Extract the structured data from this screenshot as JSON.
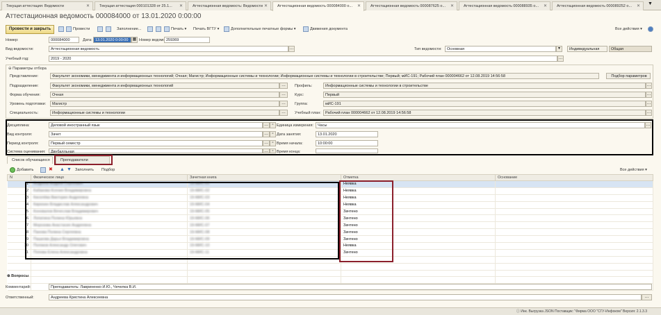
{
  "tabs": [
    {
      "label": "Текущая аттестация: Ведомости"
    },
    {
      "label": "Текущая аттестация 000101328 от 25.1..."
    },
    {
      "label": "Аттестационная ведомость: Ведомости"
    },
    {
      "label": "Аттестационная ведомость 000084000 о..."
    },
    {
      "label": "Аттестационная ведомость 000087625 о..."
    },
    {
      "label": "Аттестационная ведомость 000088935 о..."
    },
    {
      "label": "Аттестационная ведомость 000089252 о..."
    }
  ],
  "title": "Аттестационная ведомость 000084000 от 13.01.2020 0:00:00",
  "toolbar": {
    "post_close": "Провести и закрыть",
    "post": "Провести",
    "fill": "Заполнение...",
    "print": "Печать",
    "print_vgtu": "Печать ВГТУ",
    "extra_print": "Дополнительные печатные формы",
    "movements": "Движения документа",
    "all_actions": "Все действия"
  },
  "header": {
    "number_label": "Номер:",
    "number": "000084000",
    "date_label": "Дата:",
    "date": "13.01.2020 0:00:00",
    "num_ved_label": "Номер ведомости:",
    "num_ved": "259369",
    "kind_label": "Вид ведомости:",
    "kind": "Аттестационная ведомость",
    "type_label": "Тип ведомости:",
    "type": "Основная",
    "opt1": "Индивидуальная",
    "opt2": "Общая",
    "year_label": "Учебный год:",
    "year": "2019 - 2020"
  },
  "params": {
    "title": "Параметры отбора",
    "view_label": "Представление:",
    "view": "Факультет экономики, менеджмента и информационных технологий; Очная; Магистр; Информационные системы и технологии; Информационные системы и технологии в строительстве; Первый; мИС-191; Рабочий план 000004662 от 12.08.2019 14:56:58",
    "pick_btn": "Подбор параметров",
    "dept_label": "Подразделение:",
    "dept": "Факультет экономики, менеджмента и информационных технологий",
    "profile_label": "Профиль:",
    "profile": "Информационные системы и технологии в строительстве",
    "form_label": "Форма обучения:",
    "form": "Очная",
    "course_label": "Курс:",
    "course": "Первый",
    "level_label": "Уровень подготовки:",
    "level": "Магистр",
    "group_label": "Группа:",
    "group": "мИС-191",
    "spec_label": "Специальность:",
    "spec": "Информационные системы и технологии",
    "plan_label": "Учебный план:",
    "plan": "Рабочий план 000004662 от 12.08.2019 14:56:58"
  },
  "disc": {
    "disc_label": "Дисциплина:",
    "disc": "Деловой иностранный язык",
    "unit_label": "Единица измерения:",
    "unit": "Часы",
    "control_label": "Вид контроля:",
    "control": "Зачет",
    "date_label": "Дата занятия:",
    "date": "13.01.2020",
    "period_label": "Период контроля:",
    "period": "Первый семестр",
    "start_label": "Время начала:",
    "start": "10:00:00",
    "system_label": "Система оценивания:",
    "system": "Двубалльная",
    "end_label": "Время конца:"
  },
  "subtabs": {
    "students": "Список обучающихся",
    "teachers": "Преподаватели"
  },
  "gridbar": {
    "add": "Добавить",
    "fill": "Заполнить",
    "pick": "Подбор",
    "all_actions": "Все действия"
  },
  "grid": {
    "columns": [
      "N",
      "Физическое лицо",
      "Зачетная книга",
      "Отметка",
      "Основание"
    ],
    "rows": [
      {
        "n": "1",
        "person": "Андреев Андрей Сергеевич",
        "book": "19-МИС-01",
        "mark": "Неявка"
      },
      {
        "n": "2",
        "person": "Кабакова Ксения Владимировна",
        "book": "19-МИС-02",
        "mark": "Неявка"
      },
      {
        "n": "3",
        "person": "Киселёва Виктория Андреевна",
        "book": "19-МИС-03",
        "mark": "Неявка"
      },
      {
        "n": "4",
        "person": "Кирюхин Владислав Александрович",
        "book": "19-МИС-04",
        "mark": "Неявка"
      },
      {
        "n": "5",
        "person": "Коновалов Вячеслав Владимирович",
        "book": "19-МИС-05",
        "mark": "Зачтено"
      },
      {
        "n": "6",
        "person": "Лопатина Полина Юрьевна",
        "book": "19-МИС-06",
        "mark": "Зачтено"
      },
      {
        "n": "7",
        "person": "Морозова Анастасия Андреевна",
        "book": "19-МИС-07",
        "mark": "Зачтено"
      },
      {
        "n": "8",
        "person": "Панова Полина Сергеевна",
        "book": "19-МИС-08",
        "mark": "Зачтено"
      },
      {
        "n": "9",
        "person": "Пашкова Дарья Владимировна",
        "book": "19-МИС-09",
        "mark": "Зачтено"
      },
      {
        "n": "10",
        "person": "Поляков Александр Олегович",
        "book": "19-МИС-10",
        "mark": "Неявка"
      },
      {
        "n": "11",
        "person": "Попова Елена Александровна",
        "book": "19-МИС-11",
        "mark": "Зачтено"
      }
    ]
  },
  "questions": "Вопросы",
  "footer": {
    "comment_label": "Комментарий:",
    "comment": "Преподаватель: Лавриненко И.Ю., Чечелка В.И.",
    "resp_label": "Ответственный:",
    "resp": "Андреева Кристина Алексеевна"
  },
  "status": "Инк. Выгрузка JSON  Поставщик: \"Фирма ООО \"СГУ-Инфоком\"  Версия: 2.1.3.3"
}
